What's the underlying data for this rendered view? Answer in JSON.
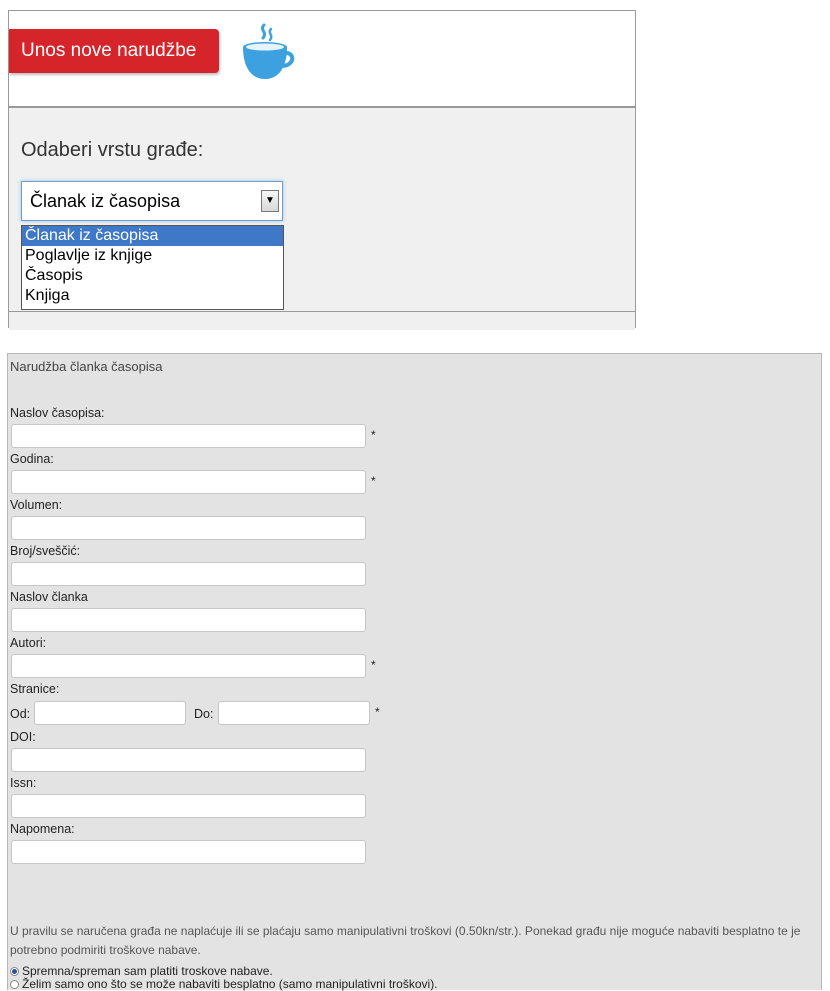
{
  "header": {
    "order_button_label": "Unos nove narudžbe",
    "cup_icon": "coffee-cup-icon",
    "icon_color": "#3da1e0"
  },
  "type_selector": {
    "label": "Odaberi vrstu građe:",
    "selected_value": "Članak iz časopisa",
    "options": [
      "Članak iz časopisa",
      "Poglavlje iz knjige",
      "Časopis",
      "Knjiga"
    ]
  },
  "form": {
    "title": "Narudžba članka časopisa",
    "required_mark": "*",
    "fields": {
      "journal_title": "Naslov časopisa:",
      "year": "Godina:",
      "volume": "Volumen:",
      "issue": "Broj/sveščić:",
      "article_title": "Naslov članka",
      "authors": "Autori:",
      "pages": "Stranice:",
      "pages_from": "Od:",
      "pages_to": "Do:",
      "doi": "DOI:",
      "issn": "Issn:",
      "note": "Napomena:"
    },
    "info_text": "U pravilu se naručena građa ne naplaćuje ili se plaćaju samo manipulativni troškovi (0.50kn/str.). Ponekad građu nije moguće nabaviti besplatno te je potrebno podmiriti troškove nabave.",
    "radio_options": [
      {
        "label": "Spremna/spreman sam platiti troskove nabave.",
        "checked": true
      },
      {
        "label": "Želim samo ono što se može nabaviti besplatno (samo manipulativni troškovi).",
        "checked": false
      }
    ]
  },
  "colors": {
    "button_red": "#d6252a",
    "selected_option_blue": "#3f78c6",
    "form_background": "#e3e3e3"
  }
}
